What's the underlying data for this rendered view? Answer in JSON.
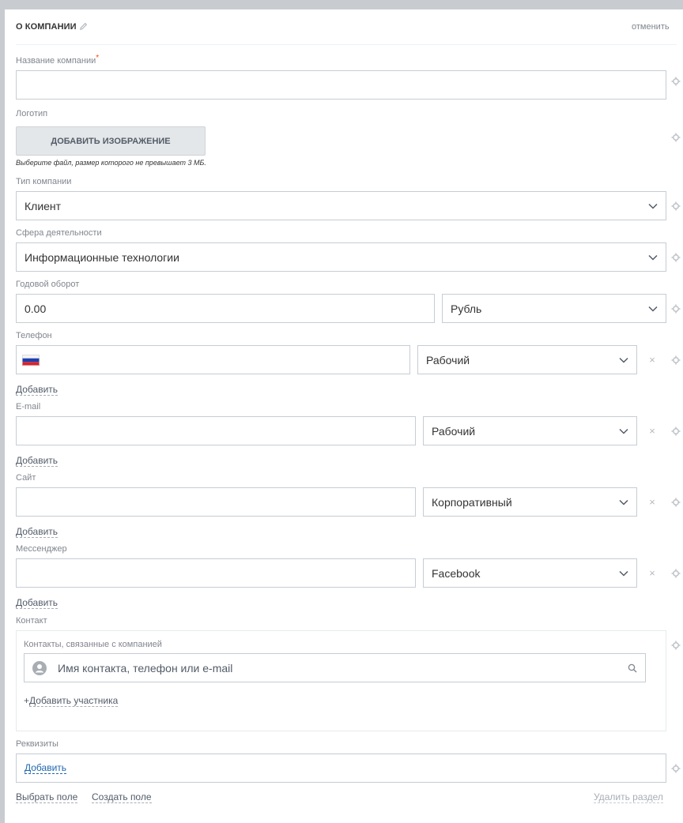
{
  "section": {
    "title": "О КОМПАНИИ",
    "cancel": "отменить"
  },
  "fields": {
    "company_name": {
      "label": "Название компании",
      "required_mark": "*",
      "value": ""
    },
    "logo": {
      "label": "Логотип",
      "button": "ДОБАВИТЬ ИЗОБРАЖЕНИЕ",
      "hint": "Выберите файл, размер которого не превышает 3 МБ."
    },
    "company_type": {
      "label": "Тип компании",
      "value": "Клиент"
    },
    "industry": {
      "label": "Сфера деятельности",
      "value": "Информационные технологии"
    },
    "revenue": {
      "label": "Годовой оборот",
      "value": "0.00",
      "currency": "Рубль"
    },
    "phone": {
      "label": "Телефон",
      "value": "",
      "type": "Рабочий",
      "add": "Добавить",
      "flag": "russia-flag"
    },
    "email": {
      "label": "E-mail",
      "value": "",
      "type": "Рабочий",
      "add": "Добавить"
    },
    "site": {
      "label": "Сайт",
      "value": "",
      "type": "Корпоративный",
      "add": "Добавить"
    },
    "messenger": {
      "label": "Мессенджер",
      "value": "",
      "type": "Facebook",
      "add": "Добавить"
    },
    "contact": {
      "label": "Контакт",
      "box_label": "Контакты, связанные с компанией",
      "placeholder": "Имя контакта, телефон или e-mail",
      "add_member": "Добавить участника",
      "add_member_prefix": "+"
    },
    "requisites": {
      "label": "Реквизиты",
      "add": "Добавить"
    }
  },
  "footer": {
    "select_field": "Выбрать поле",
    "create_field": "Создать поле",
    "delete_section": "Удалить раздел"
  },
  "colors": {
    "link_blue": "#2067b0",
    "required_red": "#f54819",
    "border": "#c6cdd3"
  }
}
